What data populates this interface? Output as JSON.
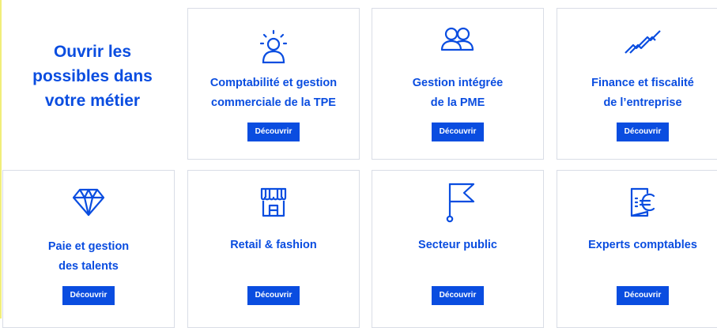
{
  "intro": {
    "line1": "Ouvrir les",
    "line2": "possibles dans",
    "line3": "votre métier"
  },
  "accent_color": "#0a4de0",
  "cards": [
    {
      "icon": "lightbulb-person-icon",
      "title_line1": "Comptabilité et gestion",
      "title_line2": "commerciale de la TPE",
      "button": "Découvrir"
    },
    {
      "icon": "users-group-icon",
      "title_line1": "Gestion intégrée",
      "title_line2": "de la PME",
      "button": "Découvrir"
    },
    {
      "icon": "trend-lines-icon",
      "title_line1": "Finance et fiscalité",
      "title_line2": "de l’entreprise",
      "button": "Découvrir"
    },
    {
      "icon": "diamond-icon",
      "title_line1": "Paie et gestion",
      "title_line2": "des talents",
      "button": "Découvrir"
    },
    {
      "icon": "storefront-icon",
      "title_line1": "Retail & fashion",
      "title_line2": "",
      "button": "Découvrir"
    },
    {
      "icon": "flag-icon",
      "title_line1": "Secteur public",
      "title_line2": "",
      "button": "Découvrir"
    },
    {
      "icon": "euro-document-icon",
      "title_line1": "Experts comptables",
      "title_line2": "",
      "button": "Découvrir"
    }
  ]
}
